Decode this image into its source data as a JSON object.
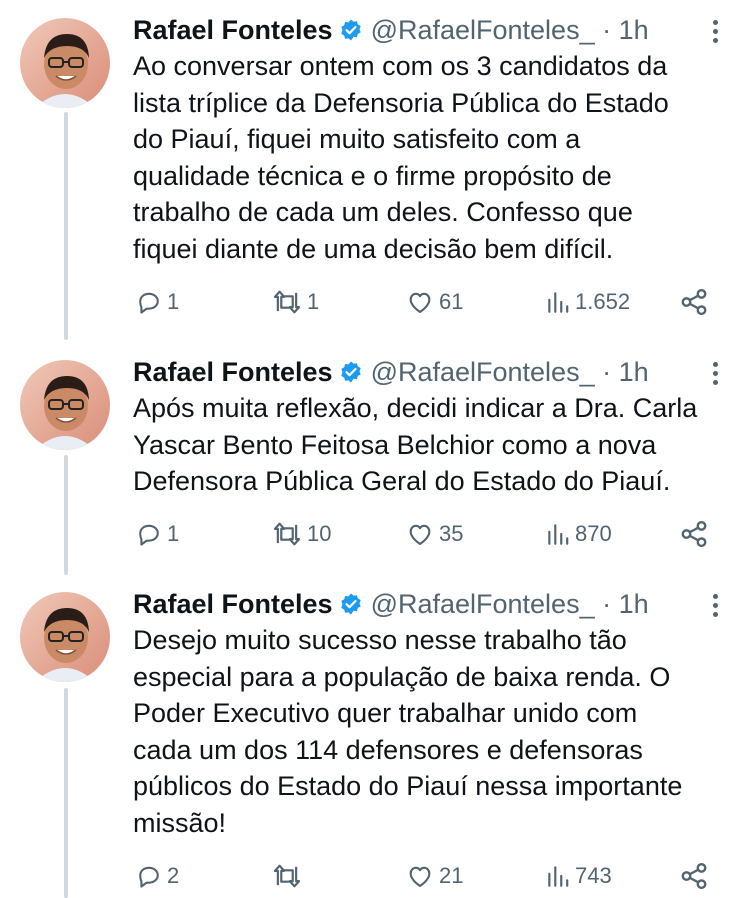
{
  "colors": {
    "text": "#0f1419",
    "secondary": "#536471",
    "verified": "#1d9bf0",
    "thread_line": "#cfd9de"
  },
  "tweets": [
    {
      "name": "Rafael Fonteles",
      "handle": "@RafaelFonteles_ · 1h",
      "text": "Ao conversar ontem com os 3 candidatos da\nlista tríplice da Defensoria Pública do Estado\ndo Piauí, fiquei muito satisfeito com a\nqualidade técnica e o firme propósito de\ntrabalho de cada um deles. Confesso que\nfiquei diante de uma decisão bem difícil.",
      "replies": "1",
      "reposts": "1",
      "likes": "61",
      "views": "1.652"
    },
    {
      "name": "Rafael Fonteles",
      "handle": "@RafaelFonteles_ · 1h",
      "text": "Após muita reflexão, decidi indicar a Dra. Carla\nYascar Bento Feitosa Belchior como a nova\nDefensora Pública Geral do Estado do Piauí.",
      "replies": "1",
      "reposts": "10",
      "likes": "35",
      "views": "870"
    },
    {
      "name": "Rafael Fonteles",
      "handle": "@RafaelFonteles_ · 1h",
      "text": "Desejo muito sucesso nesse trabalho tão\nespecial para a população de baixa renda. O\nPoder Executivo quer trabalhar unido com\ncada um dos 114 defensores e defensoras\npúblicos do Estado do Piauí nessa importante\nmissão!",
      "replies": "2",
      "reposts": "",
      "likes": "21",
      "views": "743"
    }
  ],
  "icons": {
    "reply": "reply-icon",
    "repost": "repost-icon",
    "like": "heart-icon",
    "views": "views-icon",
    "share": "share-icon",
    "verified": "verified-badge-icon",
    "more": "more-icon"
  }
}
